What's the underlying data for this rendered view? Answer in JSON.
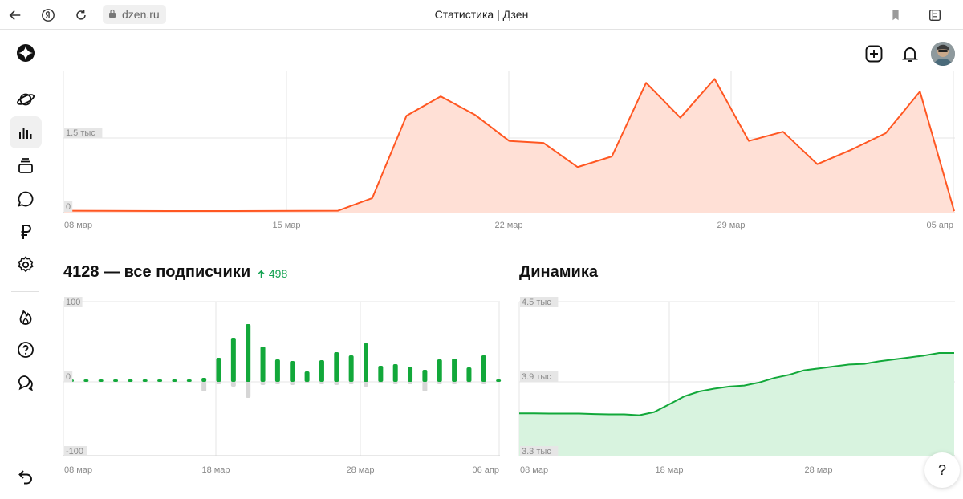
{
  "browser": {
    "url": "dzen.ru",
    "title": "Статистика | Дзен",
    "icons": [
      "back-arrow-icon",
      "yandex-icon",
      "reload-icon",
      "lock-icon",
      "bookmark-icon",
      "extensions-icon"
    ]
  },
  "sidebar": {
    "items": [
      {
        "icon": "dzen-logo-icon"
      },
      {
        "icon": "planet-icon"
      },
      {
        "icon": "statistics-icon",
        "active": true
      },
      {
        "icon": "subscriptions-icon"
      },
      {
        "icon": "comments-icon"
      },
      {
        "icon": "ruble-icon"
      },
      {
        "icon": "settings-icon"
      },
      {
        "icon": "fire-icon"
      },
      {
        "icon": "help-icon"
      },
      {
        "icon": "chat-icon"
      },
      {
        "icon": "undo-icon"
      }
    ]
  },
  "header": {
    "icons": [
      "add-icon",
      "bell-icon",
      "avatar"
    ]
  },
  "colors": {
    "orange": "#ff5722",
    "orange_fill": "#ffe0d6",
    "green": "#12a83a",
    "green_fill": "#d8f3df",
    "gray_bar": "#d6d6d6"
  },
  "top_chart": {
    "chart_data": {
      "type": "area",
      "x_ticks": [
        "08 мар",
        "15 мар",
        "22 мар",
        "29 мар",
        "05 апр"
      ],
      "y_ticks": [
        "1.5 тыс",
        "0"
      ],
      "ylim": [
        0,
        2800
      ],
      "values": [
        40,
        38,
        35,
        34,
        34,
        33,
        35,
        37,
        40,
        300,
        2000,
        2400,
        2020,
        1480,
        1440,
        940,
        1160,
        2680,
        1960,
        2760,
        1480,
        1670,
        1000,
        1300,
        1640,
        2500,
        30
      ]
    }
  },
  "subscribers": {
    "title": "4128 — все подписчики",
    "delta": "498",
    "chart_data": {
      "type": "bar",
      "x_ticks": [
        "08 мар",
        "18 мар",
        "28 мар",
        "06 апр"
      ],
      "y_ticks": [
        "100",
        "0",
        "-100"
      ],
      "ylim": [
        -100,
        100
      ],
      "positive": [
        3,
        3,
        3,
        3,
        3,
        3,
        3,
        3,
        3,
        5,
        30,
        55,
        72,
        44,
        28,
        26,
        13,
        27,
        37,
        33,
        48,
        20,
        22,
        19,
        15,
        28,
        29,
        18,
        33,
        3
      ],
      "negative": [
        0,
        0,
        0,
        0,
        0,
        0,
        0,
        0,
        0,
        -12,
        -3,
        -6,
        -20,
        -4,
        -3,
        -4,
        -2,
        -3,
        -4,
        -3,
        -6,
        -2,
        -3,
        -3,
        -12,
        -3,
        -3,
        -2,
        -3,
        0
      ]
    }
  },
  "dynamics": {
    "title": "Динамика",
    "chart_data": {
      "type": "area",
      "x_ticks": [
        "08 мар",
        "18 мар",
        "28 мар"
      ],
      "y_ticks": [
        "4.5 тыс",
        "3.9 тыс",
        "3.3 тыс"
      ],
      "ylim": [
        3300,
        4500
      ],
      "values": [
        3630,
        3630,
        3628,
        3628,
        3628,
        3624,
        3622,
        3622,
        3615,
        3640,
        3700,
        3762,
        3800,
        3822,
        3838,
        3846,
        3870,
        3905,
        3930,
        3965,
        3980,
        3995,
        4010,
        4015,
        4035,
        4050,
        4065,
        4080,
        4100,
        4100
      ]
    }
  },
  "help": {
    "label": "?"
  }
}
